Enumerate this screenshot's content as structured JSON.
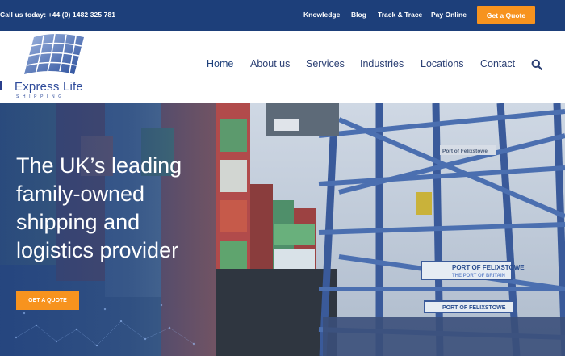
{
  "topbar": {
    "phone": "Call us today: +44 (0) 1482 325 781",
    "links": [
      "Knowledge",
      "Blog",
      "Track & Trace",
      "Pay Online"
    ],
    "quote_label": "Get a Quote"
  },
  "logo": {
    "name": "Express Life",
    "sub": "SHIPPING"
  },
  "nav": {
    "items": [
      "Home",
      "About us",
      "Services",
      "Industries",
      "Locations",
      "Contact"
    ],
    "active": "Home",
    "search_icon": "search-icon"
  },
  "hero": {
    "headline": [
      "The UK’s leading",
      "family-owned",
      "shipping and",
      "logistics provider"
    ],
    "cta_label": "GET A QUOTE",
    "signs": [
      "PORT OF FELIXSTOWE",
      "THE PORT OF BRITAIN",
      "PORT OF FELIXSTOWE",
      "Port of Felixstowe"
    ]
  },
  "colors": {
    "topbar": "#1d3f7a",
    "accent": "#f7931e",
    "nav_text": "#2b3f73"
  }
}
